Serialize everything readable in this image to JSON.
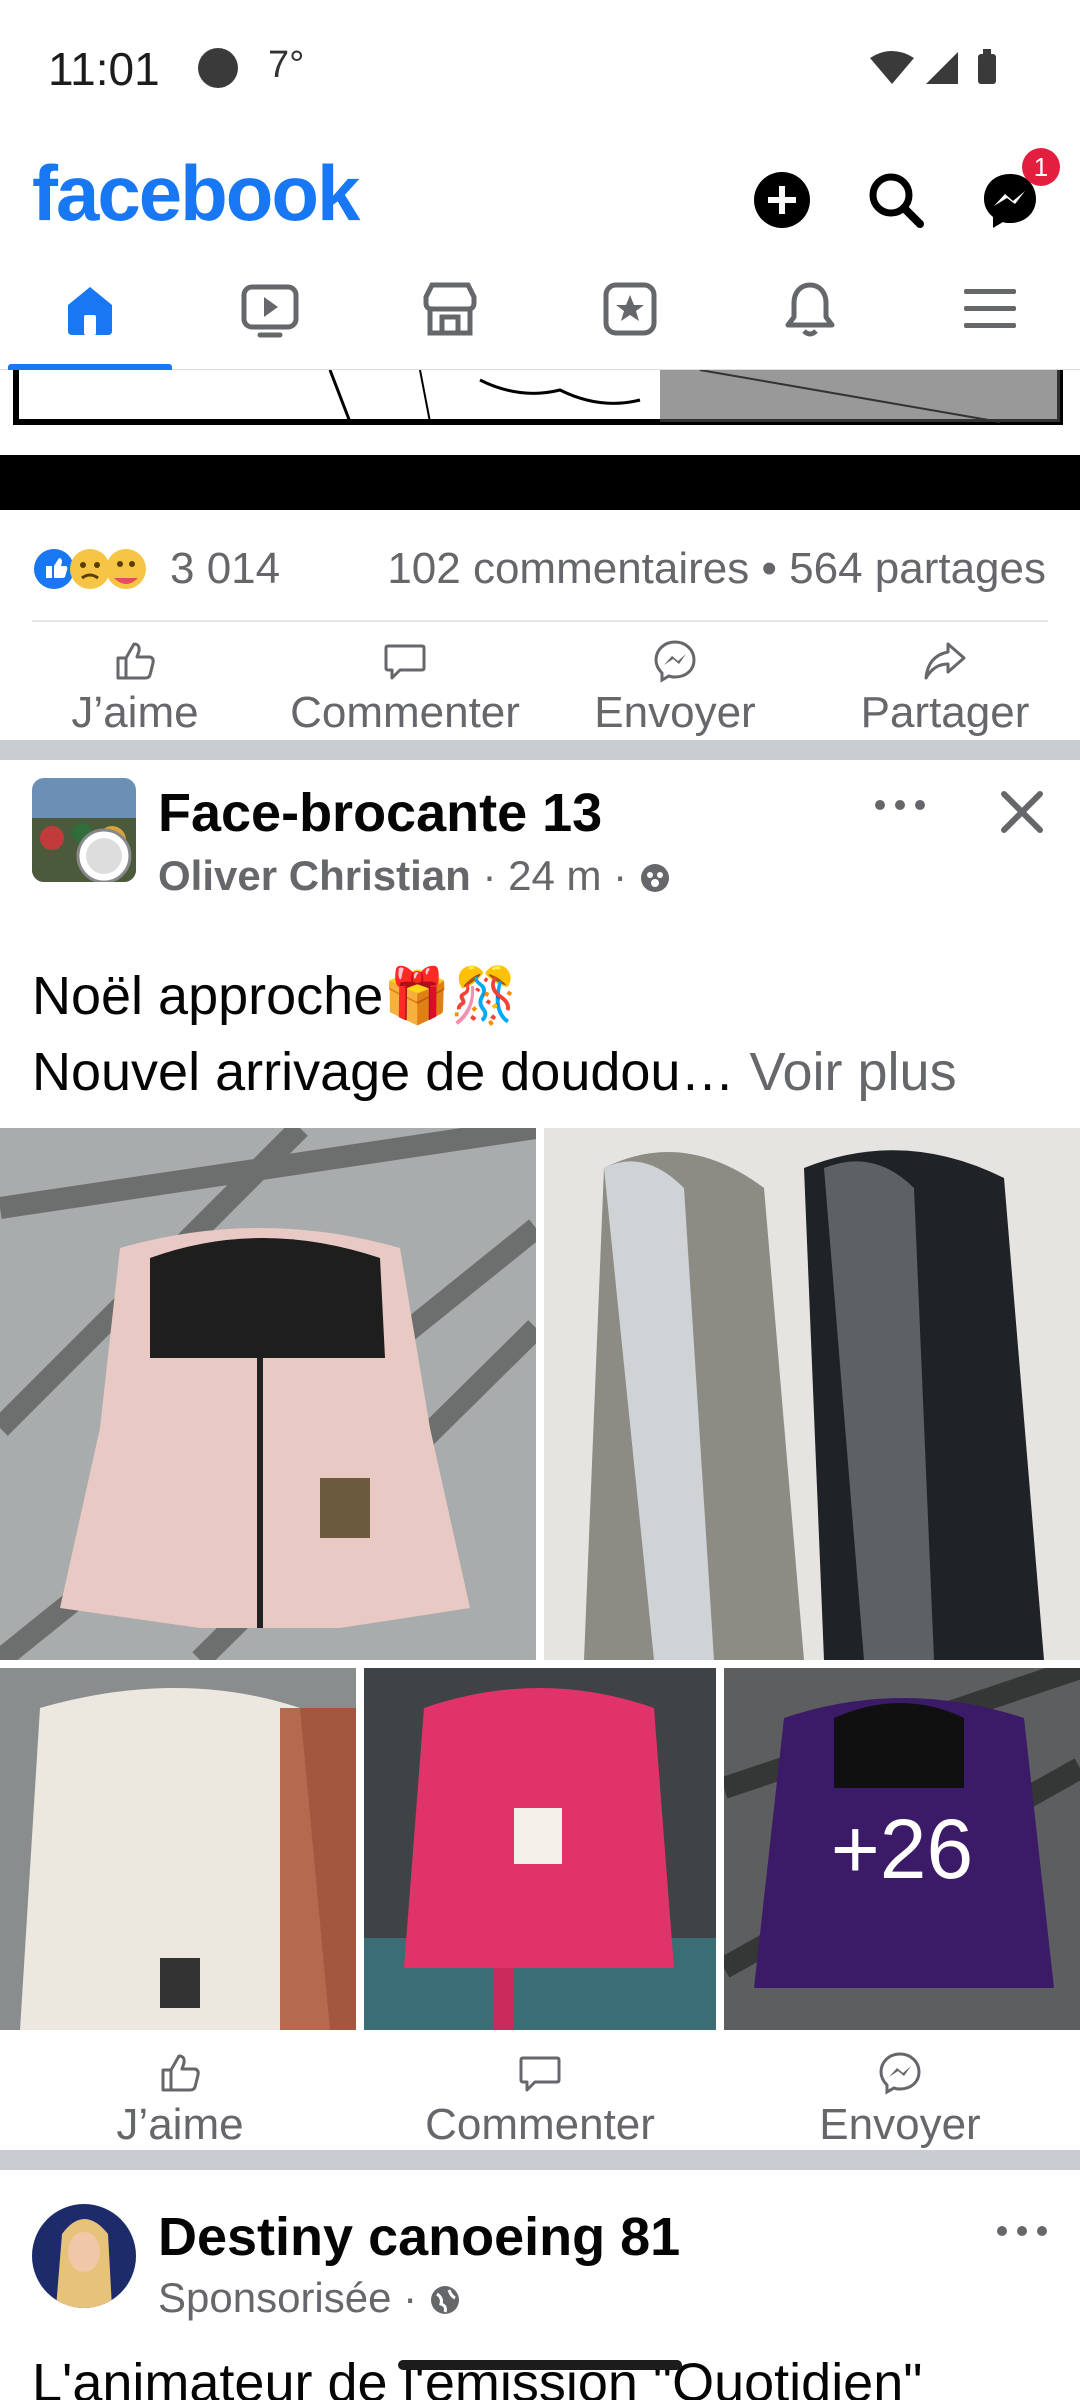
{
  "status_bar": {
    "time": "11:01",
    "temperature": "7°"
  },
  "header": {
    "brand": "facebook",
    "messenger_badge": "1",
    "icons": [
      "plus-icon",
      "search-icon",
      "messenger-icon"
    ]
  },
  "tabs": [
    {
      "name": "home",
      "icon": "home-icon",
      "active": true
    },
    {
      "name": "watch",
      "icon": "video-icon",
      "active": false
    },
    {
      "name": "marketplace",
      "icon": "store-icon",
      "active": false
    },
    {
      "name": "pages",
      "icon": "flag-star-icon",
      "active": false
    },
    {
      "name": "notifications",
      "icon": "bell-icon",
      "active": false
    },
    {
      "name": "menu",
      "icon": "hamburger-icon",
      "active": false
    }
  ],
  "post1": {
    "reaction_count": "3 014",
    "comments_shares": "102 commentaires • 564 partages",
    "actions": {
      "like": "J’aime",
      "comment": "Commenter",
      "send": "Envoyer",
      "share": "Partager"
    }
  },
  "post2": {
    "group_name": "Face-brocante 13",
    "author": "Oliver Christian",
    "time": "· 24 m ·",
    "text_line1": "Noël approche🎁🎊",
    "text_line2": "Nouvel arrivage de doudou…",
    "see_more": "Voir plus",
    "more_count": "+26",
    "actions": {
      "like": "J’aime",
      "comment": "Commenter",
      "send": "Envoyer"
    },
    "image_colors": [
      "#e8c9c4",
      "#8c8c85",
      "#ece8e0",
      "#e0336a",
      "#5b2a9e"
    ]
  },
  "post3": {
    "page_name": "Destiny canoeing 81",
    "sponsored": "Sponsorisée ·",
    "text": "L'animateur de l'émission \"Quotidien\""
  },
  "colors": {
    "brand_blue": "#1877f2",
    "badge_red": "#e41e3f",
    "muted": "#65676b"
  }
}
